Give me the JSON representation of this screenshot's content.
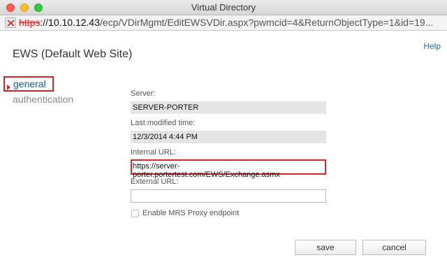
{
  "window": {
    "title": "Virtual Directory"
  },
  "address_bar": {
    "scheme": "https",
    "separator": "://",
    "host": "10.10.12.43",
    "path": "/ecp/VDirMgmt/EditEWSVDir.aspx?pwmcid=4&ReturnObjectType=1&id=19...",
    "icon": "broken-lock-icon"
  },
  "header": {
    "title": "EWS (Default Web Site)",
    "help_label": "Help"
  },
  "nav": {
    "items": [
      {
        "label": "general",
        "selected": true
      },
      {
        "label": "authentication",
        "selected": false
      }
    ]
  },
  "form": {
    "server": {
      "label": "Server:",
      "value": "SERVER-PORTER"
    },
    "last_modified": {
      "label": "Last modified time:",
      "value": "12/3/2014 4:44 PM"
    },
    "internal_url": {
      "label": "Internal URL:",
      "value": "https://server-porter.portertest.com/EWS/Exchange.asmx"
    },
    "external_url": {
      "label": "External URL:",
      "value": ""
    },
    "mrs_proxy": {
      "label": "Enable MRS Proxy endpoint",
      "checked": false
    }
  },
  "buttons": {
    "save": "save",
    "cancel": "cancel"
  },
  "colors": {
    "highlight": "#d7222a",
    "link": "#1a6fb5",
    "nav_selected": "#1a5a9c"
  }
}
